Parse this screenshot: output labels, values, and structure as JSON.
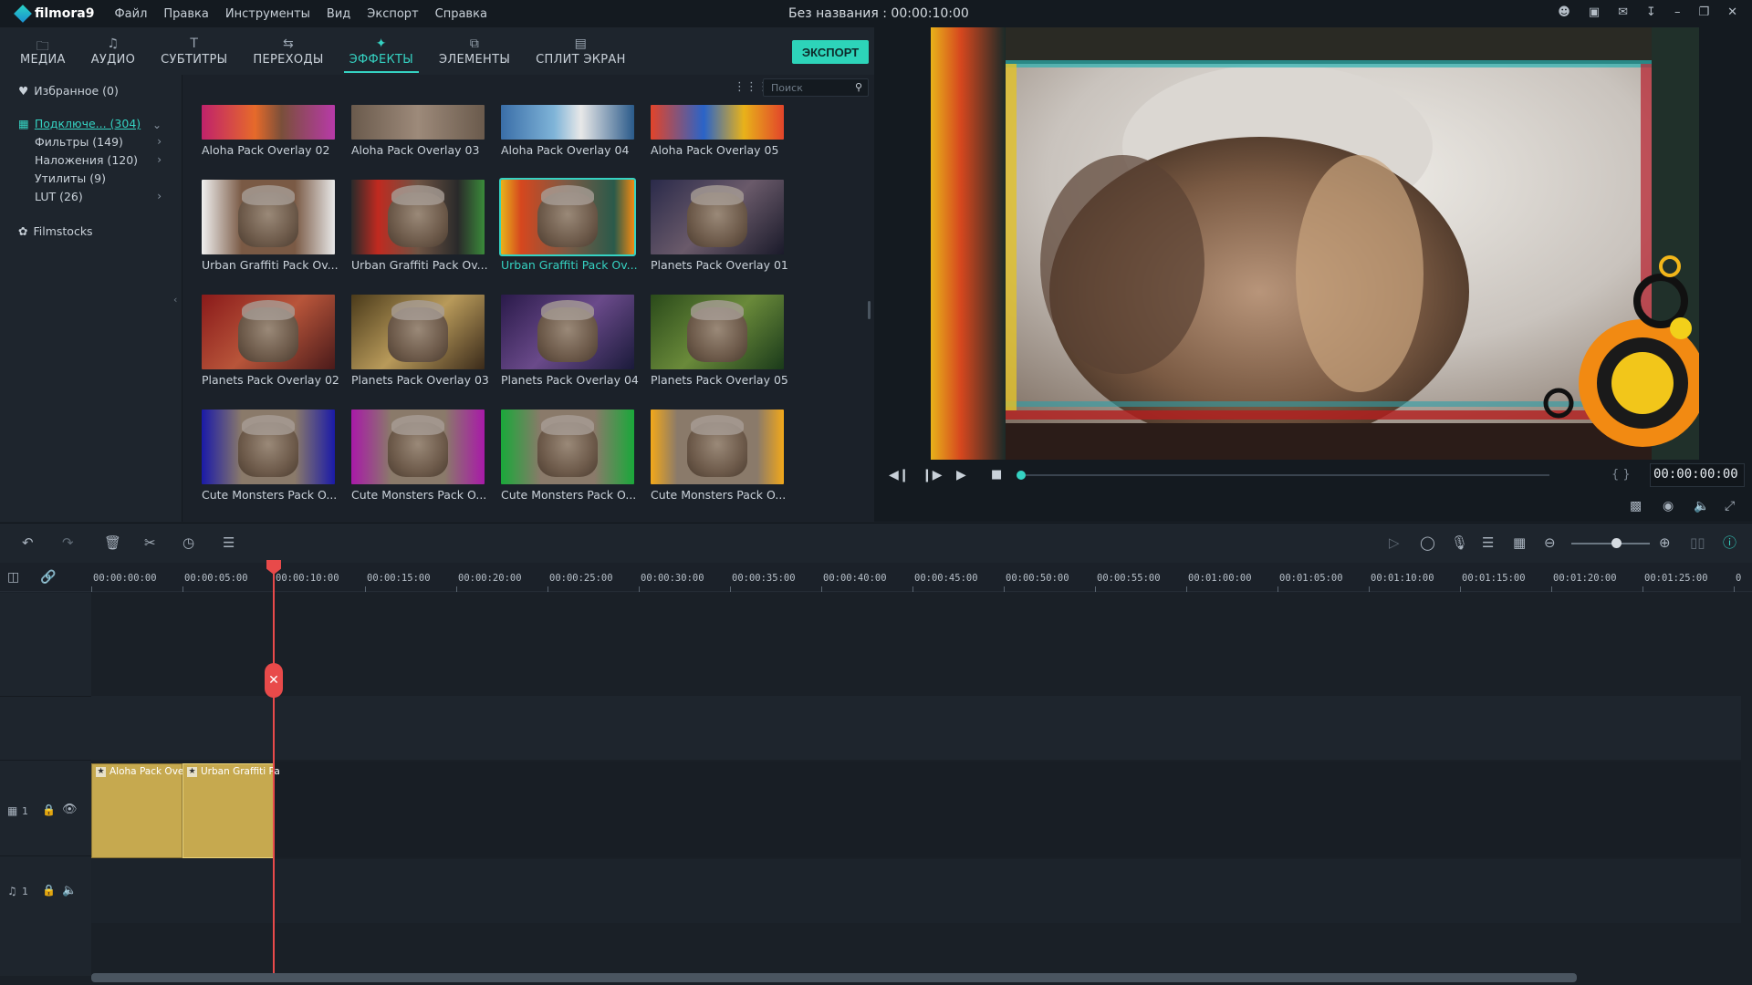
{
  "app": {
    "logo_text": "filmora9",
    "window_title": "Без названия : 00:00:10:00",
    "menu": [
      "Файл",
      "Правка",
      "Инструменты",
      "Вид",
      "Экспорт",
      "Справка"
    ]
  },
  "tabs": [
    {
      "label": "МЕДИА",
      "icon": "folder-icon"
    },
    {
      "label": "АУДИО",
      "icon": "music-note-icon"
    },
    {
      "label": "СУБТИТРЫ",
      "icon": "text-icon"
    },
    {
      "label": "ПЕРЕХОДЫ",
      "icon": "transition-icon"
    },
    {
      "label": "ЭФФЕКТЫ",
      "icon": "effects-icon",
      "active": true
    },
    {
      "label": "ЭЛЕМЕНТЫ",
      "icon": "elements-icon"
    },
    {
      "label": "СПЛИТ ЭКРАН",
      "icon": "split-screen-icon"
    }
  ],
  "export_label": "ЭКСПОРТ",
  "sidebar": {
    "favorites": "Избранное (0)",
    "connected": "Подключе... (304)",
    "items": [
      "Фильтры (149)",
      "Наложения (120)",
      "Утилиты (9)",
      "LUT (26)"
    ],
    "filmstocks": "Filmstocks"
  },
  "search": {
    "placeholder": "Поиск"
  },
  "effects": [
    {
      "label": "Aloha Pack Overlay 02",
      "style": "aloha2"
    },
    {
      "label": "Aloha Pack Overlay 03",
      "style": "aloha3"
    },
    {
      "label": "Aloha Pack Overlay 04",
      "style": "aloha4"
    },
    {
      "label": "Aloha Pack Overlay 05",
      "style": "aloha5"
    },
    {
      "label": "Urban Graffiti Pack Ov...",
      "style": "graffiti1"
    },
    {
      "label": "Urban Graffiti Pack Ov...",
      "style": "graffiti2"
    },
    {
      "label": "Urban Graffiti Pack Ov...",
      "style": "graffiti3",
      "selected": true
    },
    {
      "label": "Planets Pack Overlay 01",
      "style": "planet1"
    },
    {
      "label": "Planets Pack Overlay 02",
      "style": "planet2"
    },
    {
      "label": "Planets Pack Overlay 03",
      "style": "planet3"
    },
    {
      "label": "Planets Pack Overlay 04",
      "style": "planet4"
    },
    {
      "label": "Planets Pack Overlay 05",
      "style": "planet5"
    },
    {
      "label": "Cute Monsters Pack O...",
      "style": "monster1"
    },
    {
      "label": "Cute Monsters Pack O...",
      "style": "monster2"
    },
    {
      "label": "Cute Monsters Pack O...",
      "style": "monster3"
    },
    {
      "label": "Cute Monsters Pack O...",
      "style": "monster4"
    }
  ],
  "preview": {
    "timecode": "00:00:00:00",
    "progress": 0.0
  },
  "ruler": [
    "00:00:00:00",
    "00:00:05:00",
    "00:00:10:00",
    "00:00:15:00",
    "00:00:20:00",
    "00:00:25:00",
    "00:00:30:00",
    "00:00:35:00",
    "00:00:40:00",
    "00:00:45:00",
    "00:00:50:00",
    "00:00:55:00",
    "00:01:00:00",
    "00:01:05:00",
    "00:01:10:00",
    "00:01:15:00",
    "00:01:20:00",
    "00:01:25:00",
    "0"
  ],
  "tracks": {
    "video_track_num": "1",
    "audio_track_num": "1"
  },
  "clips": [
    {
      "label": "Aloha Pack Ove"
    },
    {
      "label": "Urban Graffiti Pa"
    }
  ],
  "colors": {
    "accent": "#35d2c2",
    "playhead": "#e84a4a",
    "clip": "#c6a94f"
  }
}
